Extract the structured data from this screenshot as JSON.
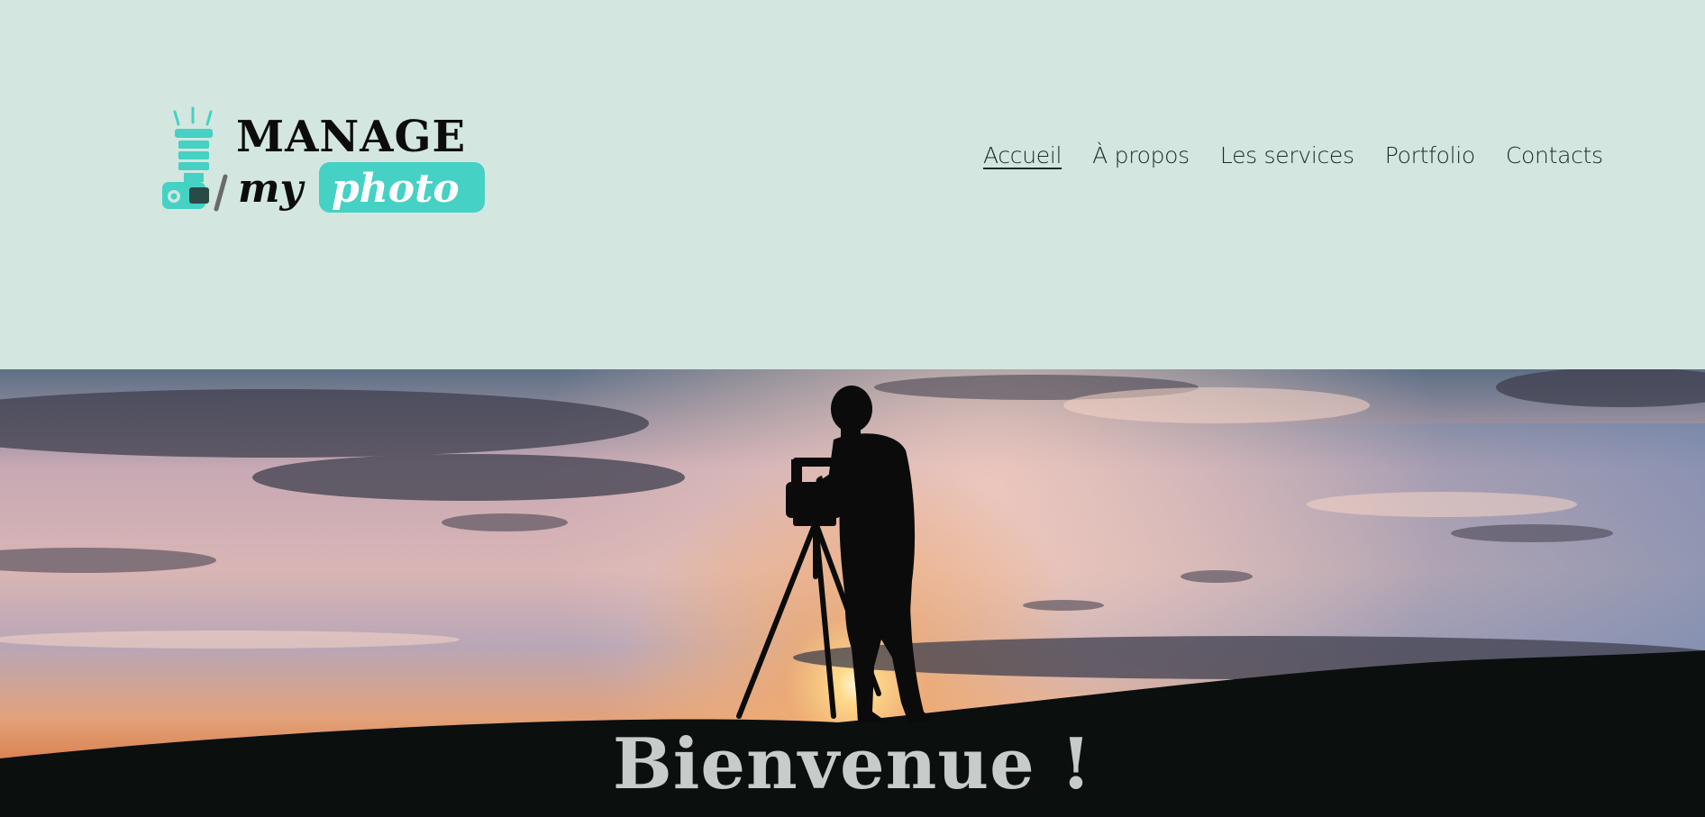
{
  "brand": {
    "line1": "MANAGE",
    "line2_word1": "my",
    "line2_word2": "photo",
    "accent_color": "#45d1c3"
  },
  "nav": {
    "items": [
      {
        "label": "Accueil",
        "active": true
      },
      {
        "label": "À propos",
        "active": false
      },
      {
        "label": "Les services",
        "active": false
      },
      {
        "label": "Portfolio",
        "active": false
      },
      {
        "label": "Contacts",
        "active": false
      }
    ]
  },
  "hero": {
    "image": "sunset-cameraman-silhouette",
    "title": "Bienvenue !"
  },
  "colors": {
    "header_bg": "#d3e6e0",
    "nav_text": "#1c2b2a",
    "title_text": "#c7ccca"
  }
}
